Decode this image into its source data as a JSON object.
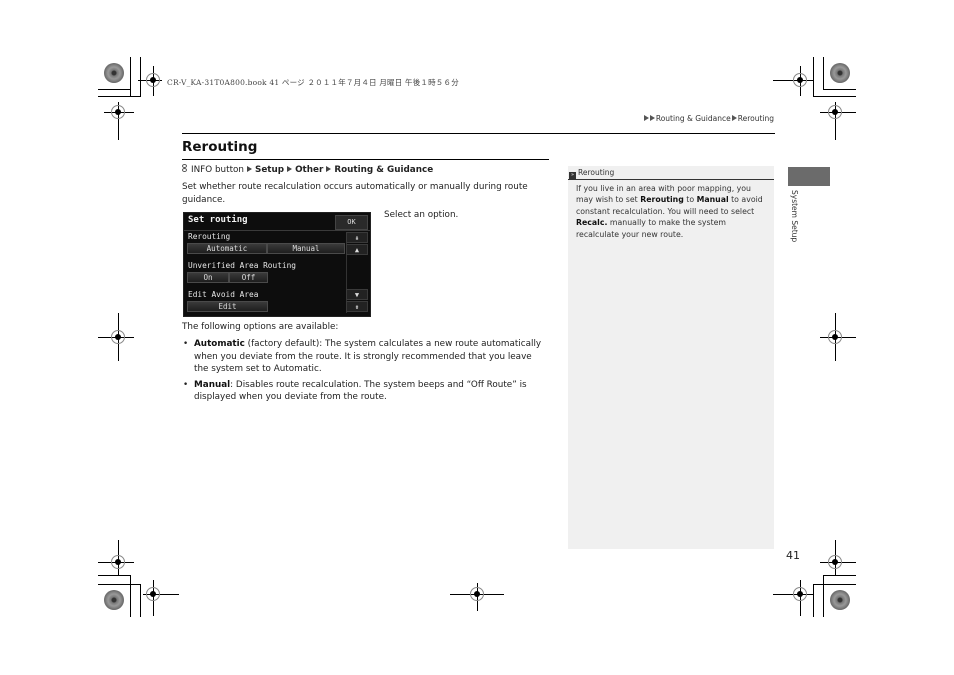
{
  "print_meta": "CR-V_KA-31T0A800.book  41 ページ  ２０１１年７月４日  月曜日  午後１時５６分",
  "breadcrumb": {
    "items": [
      "Routing & Guidance",
      "Rerouting"
    ]
  },
  "page": {
    "title": "Rerouting",
    "path": {
      "start": "INFO button",
      "steps": [
        "Setup",
        "Other",
        "Routing & Guidance"
      ]
    },
    "intro": "Set whether route recalculation occurs automatically or manually during route guidance.",
    "select_instruction": "Select an option.",
    "following": "The following options are available:",
    "options": [
      {
        "name": "Automatic",
        "text": " (factory default): The system calculates a new route automatically when you deviate from the route. It is strongly recommended that you leave the system set to Automatic."
      },
      {
        "name": "Manual",
        "text": ": Disables route recalculation. The system beeps and “Off Route” is displayed when you deviate from the route."
      }
    ]
  },
  "screen": {
    "title": "Set routing",
    "ok": "OK",
    "sections": [
      {
        "label": "Rerouting",
        "buttons": [
          "Automatic",
          "Manual"
        ]
      },
      {
        "label": "Unverified Area Routing",
        "buttons": [
          "On",
          "Off"
        ]
      },
      {
        "label": "Edit Avoid Area",
        "buttons": [
          "Edit"
        ]
      }
    ],
    "scroll": [
      "page-up-icon",
      "up-icon",
      "down-icon",
      "page-down-icon"
    ],
    "scroll_glyphs": [
      "⇞",
      "▲",
      "▼",
      "⇟"
    ]
  },
  "note": {
    "heading": "Rerouting",
    "body_parts": [
      "If you live in an area with poor mapping, you may wish to set ",
      "Rerouting",
      " to ",
      "Manual",
      " to avoid constant recalculation. You will need to select ",
      "Recalc.",
      " manually to make the system recalculate your new route."
    ]
  },
  "side_tab": {
    "label": "System Setup",
    "color": "#6b6b6b"
  },
  "page_number": "41"
}
